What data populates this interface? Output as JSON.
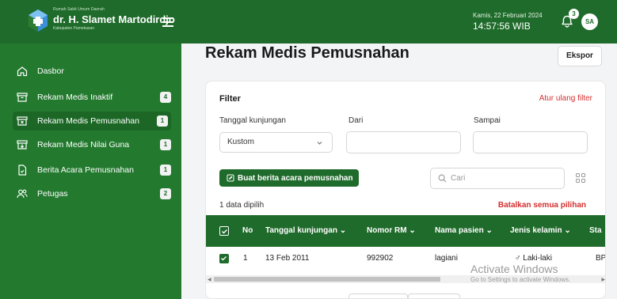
{
  "header": {
    "hospital_small": "Rumah Sakit Umum Daerah",
    "hospital_name": "dr. H. Slamet Martodirdjo",
    "hospital_region": "Kabupaten Pamekasan",
    "date": "Kamis, 22 Februari 2024",
    "time": "14:57:56 WIB",
    "notification_count": "3",
    "avatar_initials": "SA"
  },
  "sidebar": {
    "items": [
      {
        "label": "Dasbor",
        "icon": "home-icon"
      },
      {
        "label": "Rekam Medis Inaktif",
        "icon": "archive-icon",
        "count": "4"
      },
      {
        "label": "Rekam Medis Pemusnahan",
        "icon": "archive-x-icon",
        "count": "1"
      },
      {
        "label": "Rekam Medis Nilai Guna",
        "icon": "archive-down-icon",
        "count": "1"
      },
      {
        "label": "Berita Acara Pemusnahan",
        "icon": "document-icon",
        "count": "1"
      },
      {
        "label": "Petugas",
        "icon": "users-icon",
        "count": "2"
      }
    ]
  },
  "main": {
    "title": "Rekam Medis Pemusnahan",
    "export_label": "Ekspor",
    "filter": {
      "title": "Filter",
      "reset_label": "Atur ulang filter",
      "visit_date_label": "Tanggal kunjungan",
      "visit_date_value": "Kustom",
      "from_label": "Dari",
      "to_label": "Sampai"
    },
    "create_label": "Buat berita acara pemusnahan",
    "search_placeholder": "Cari",
    "selected_text": "1 data dipilih",
    "cancel_all_label": "Batalkan semua pilihan",
    "table": {
      "columns": [
        "No",
        "Tanggal kunjungan",
        "Nomor RM",
        "Nama pasien",
        "Jenis kelamin",
        "Sta"
      ],
      "rows": [
        {
          "no": "1",
          "visit_date": "13 Feb 2011",
          "rm": "992902",
          "name": "lagiani",
          "gender": "Laki-laki",
          "status": "BP."
        }
      ]
    }
  },
  "watermark": {
    "line1": "Activate Windows",
    "line2": "Go to Settings to activate Windows."
  },
  "colors": {
    "primary": "#1f6b2b",
    "sidebar": "#237a2f",
    "danger": "#d32f2f"
  }
}
